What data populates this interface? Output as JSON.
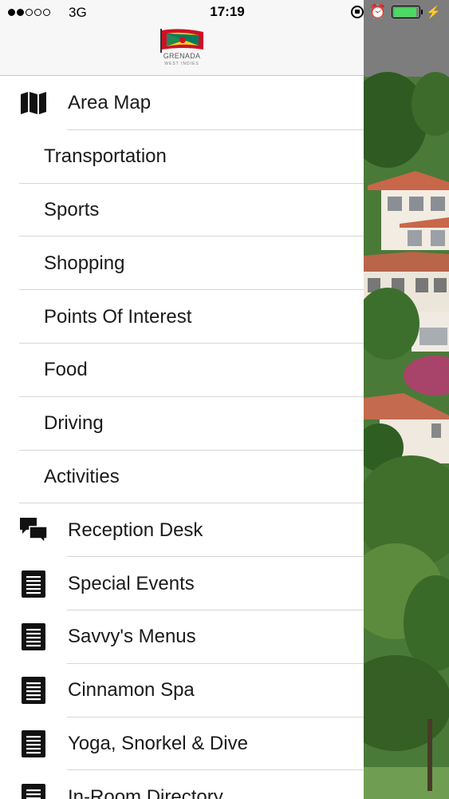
{
  "status_bar": {
    "carrier": "3G",
    "time": "17:19",
    "signal_bars_filled": 2,
    "signal_bars_total": 5,
    "battery_level": 0.9,
    "battery_color": "#4cd964"
  },
  "header": {
    "logo_title": "GRENADA",
    "logo_subtitle": "WEST INDIES",
    "background": "#f7f7f7"
  },
  "menu": {
    "items": [
      {
        "label": "Area Map",
        "icon": "map-icon",
        "level": "top"
      },
      {
        "label": "Transportation",
        "level": "sub"
      },
      {
        "label": "Sports",
        "level": "sub"
      },
      {
        "label": "Shopping",
        "level": "sub"
      },
      {
        "label": "Points Of Interest",
        "level": "sub"
      },
      {
        "label": "Food",
        "level": "sub"
      },
      {
        "label": "Driving",
        "level": "sub"
      },
      {
        "label": "Activities",
        "level": "sub"
      },
      {
        "label": "Reception Desk",
        "icon": "chat-bubbles-icon",
        "level": "top"
      },
      {
        "label": "Special Events",
        "icon": "document-icon",
        "level": "top"
      },
      {
        "label": "Savvy's Menus",
        "icon": "document-icon",
        "level": "top"
      },
      {
        "label": "Cinnamon Spa",
        "icon": "document-icon",
        "level": "top"
      },
      {
        "label": "Yoga, Snorkel & Dive",
        "icon": "document-icon",
        "level": "top"
      },
      {
        "label": "In-Room Directory",
        "icon": "document-icon",
        "level": "top"
      }
    ]
  }
}
